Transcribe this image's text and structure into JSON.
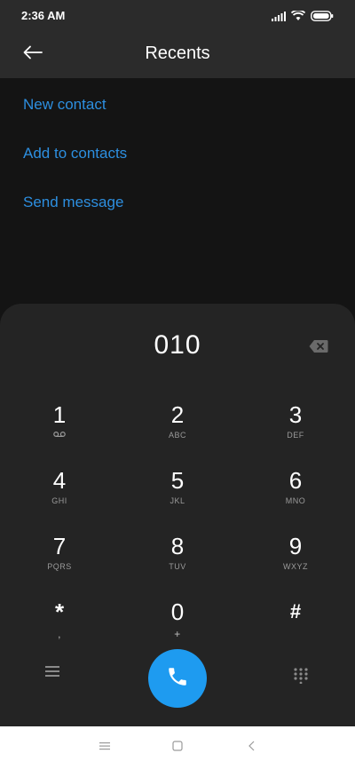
{
  "status_bar": {
    "time": "2:36 AM",
    "icons": [
      "signal-icon",
      "wifi-icon",
      "battery-icon"
    ]
  },
  "header": {
    "title": "Recents",
    "back_icon": "arrow-left-icon"
  },
  "actions": [
    {
      "label": "New contact"
    },
    {
      "label": "Add to contacts"
    },
    {
      "label": "Send message"
    }
  ],
  "dialer": {
    "number": "010",
    "backspace_icon": "backspace-icon",
    "keys": [
      {
        "digit": "1",
        "letters": ""
      },
      {
        "digit": "2",
        "letters": "ABC"
      },
      {
        "digit": "3",
        "letters": "DEF"
      },
      {
        "digit": "4",
        "letters": "GHI"
      },
      {
        "digit": "5",
        "letters": "JKL"
      },
      {
        "digit": "6",
        "letters": "MNO"
      },
      {
        "digit": "7",
        "letters": "PQRS"
      },
      {
        "digit": "8",
        "letters": "TUV"
      },
      {
        "digit": "9",
        "letters": "WXYZ"
      },
      {
        "digit": "*",
        "letters": ","
      },
      {
        "digit": "0",
        "letters": "+"
      },
      {
        "digit": "#",
        "letters": ""
      }
    ],
    "voicemail_icon": "voicemail-icon",
    "menu_icon": "menu-icon",
    "call_icon": "phone-icon",
    "keypad_icon": "keypad-icon"
  },
  "colors": {
    "accent": "#2d8fe0",
    "call_button": "#1e9bf0",
    "background": "#141414",
    "panel": "#242424"
  },
  "nav_bar": {
    "icons": [
      "menu-lines-icon",
      "home-square-icon",
      "back-chevron-icon"
    ]
  }
}
